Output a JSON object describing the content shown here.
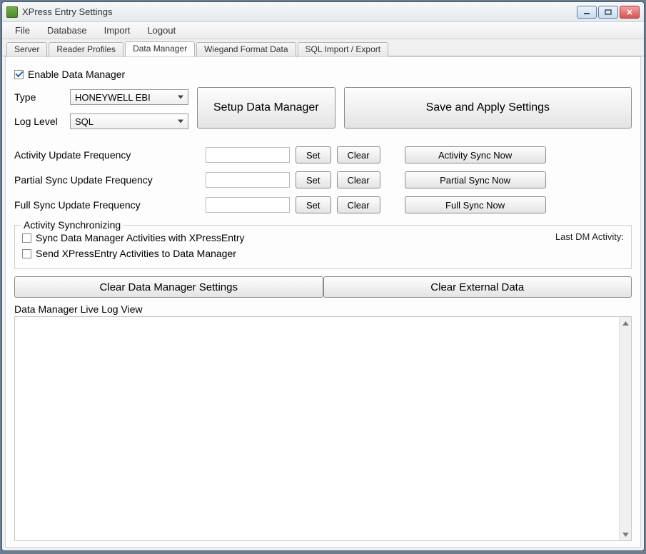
{
  "window": {
    "title": "XPress Entry Settings"
  },
  "menu": {
    "items": [
      "File",
      "Database",
      "Import",
      "Logout"
    ]
  },
  "tabs": {
    "items": [
      "Server",
      "Reader Profiles",
      "Data Manager",
      "Wiegand Format Data",
      "SQL Import / Export"
    ],
    "active_index": 2
  },
  "main": {
    "enable_label": "Enable Data Manager",
    "enable_checked": true,
    "type": {
      "label": "Type",
      "value": "HONEYWELL EBI"
    },
    "loglevel": {
      "label": "Log Level",
      "value": "SQL"
    },
    "setup_btn": "Setup Data Manager",
    "save_btn": "Save and Apply Settings",
    "freq": {
      "rows": [
        {
          "label": "Activity Update Frequency",
          "value": "",
          "set": "Set",
          "clear": "Clear",
          "sync": "Activity Sync Now"
        },
        {
          "label": "Partial Sync Update Frequency",
          "value": "",
          "set": "Set",
          "clear": "Clear",
          "sync": "Partial Sync Now"
        },
        {
          "label": "Full Sync Update Frequency",
          "value": "",
          "set": "Set",
          "clear": "Clear",
          "sync": "Full Sync Now"
        }
      ]
    },
    "activity_sync": {
      "legend": "Activity Synchronizing",
      "chk1": "Sync Data Manager Activities with XPressEntry",
      "chk2": "Send XPressEntry Activities to Data Manager",
      "last_dm": "Last DM Activity:"
    },
    "clear_settings_btn": "Clear Data Manager Settings",
    "clear_external_btn": "Clear External Data",
    "log_label": "Data Manager Live Log View"
  }
}
